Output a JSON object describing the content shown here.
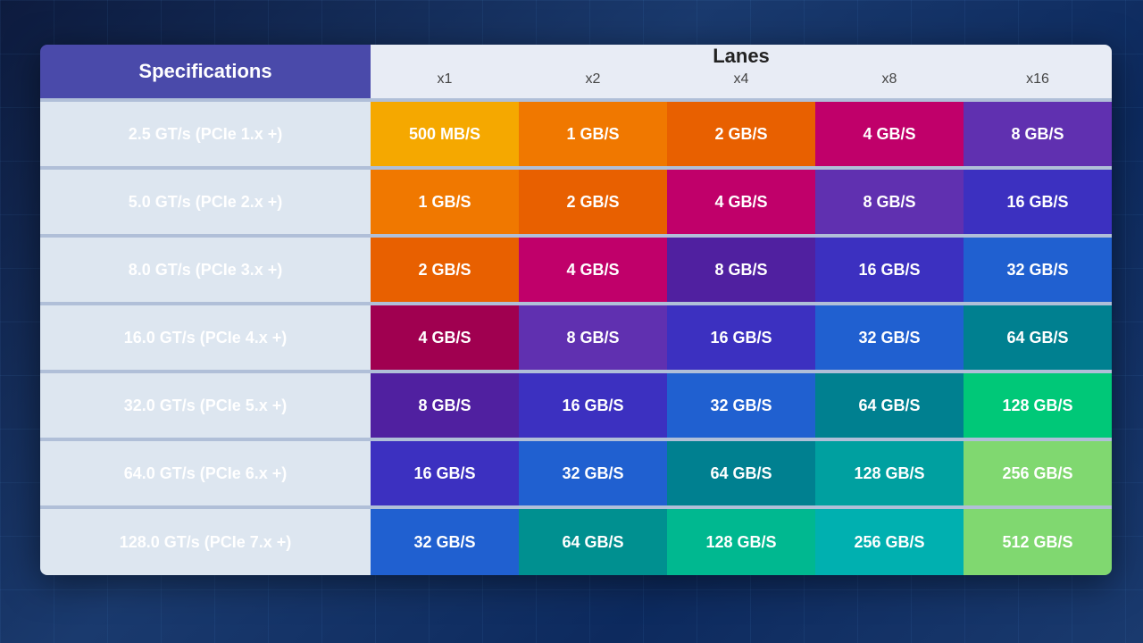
{
  "header": {
    "specs_label": "Specifications",
    "lanes_label": "Lanes",
    "lane_cols": [
      "x1",
      "x2",
      "x4",
      "x8",
      "x16"
    ]
  },
  "rows": [
    {
      "spec": "2.5 GT/s (PCIe 1.x +)",
      "values": [
        "500 MB/S",
        "1 GB/S",
        "2 GB/S",
        "4 GB/S",
        "8 GB/S"
      ]
    },
    {
      "spec": "5.0 GT/s (PCIe 2.x +)",
      "values": [
        "1 GB/S",
        "2 GB/S",
        "4 GB/S",
        "8 GB/S",
        "16 GB/S"
      ]
    },
    {
      "spec": "8.0 GT/s (PCIe 3.x +)",
      "values": [
        "2 GB/S",
        "4 GB/S",
        "8 GB/S",
        "16 GB/S",
        "32 GB/S"
      ]
    },
    {
      "spec": "16.0 GT/s (PCIe 4.x +)",
      "values": [
        "4 GB/S",
        "8 GB/S",
        "16 GB/S",
        "32 GB/S",
        "64 GB/S"
      ]
    },
    {
      "spec": "32.0 GT/s (PCIe 5.x +)",
      "values": [
        "8 GB/S",
        "16 GB/S",
        "32 GB/S",
        "64 GB/S",
        "128 GB/S"
      ]
    },
    {
      "spec": "64.0 GT/s (PCIe 6.x +)",
      "values": [
        "16 GB/S",
        "32 GB/S",
        "64 GB/S",
        "128 GB/S",
        "256 GB/S"
      ]
    },
    {
      "spec": "128.0 GT/s (PCIe 7.x +)",
      "values": [
        "32 GB/S",
        "64 GB/S",
        "128 GB/S",
        "256 GB/S",
        "512 GB/S"
      ]
    }
  ],
  "cell_colors": [
    [
      "c-yellow",
      "c-orange",
      "c-orange2",
      "c-magenta",
      "c-purple"
    ],
    [
      "c-orange",
      "c-orange2",
      "c-magenta",
      "c-purple",
      "c-indigo"
    ],
    [
      "c-orange2",
      "c-magenta",
      "c-purple2",
      "c-indigo",
      "c-royalblue"
    ],
    [
      "c-crimson",
      "c-purple",
      "c-indigo",
      "c-royalblue",
      "c-teal"
    ],
    [
      "c-purple2",
      "c-indigo",
      "c-royalblue",
      "c-teal",
      "c-green"
    ],
    [
      "c-indigo",
      "c-royalblue",
      "c-teal",
      "c-cyan",
      "c-green2"
    ],
    [
      "c-royalblue",
      "c-teal2",
      "c-seafoam",
      "c-cyan2",
      "c-green2"
    ]
  ]
}
